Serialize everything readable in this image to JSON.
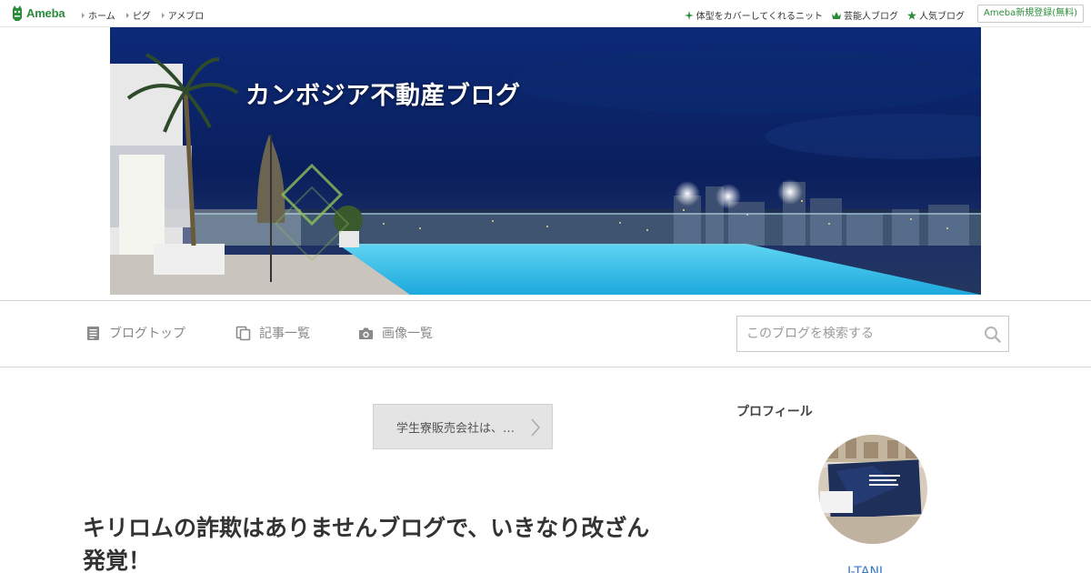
{
  "global_nav": {
    "logo_text": "Ameba",
    "links": [
      "ホーム",
      "ピグ",
      "アメブロ"
    ],
    "promo_links": [
      {
        "label": "体型をカバーしてくれるニット",
        "icon": "sparkle-icon"
      },
      {
        "label": "芸能人ブログ",
        "icon": "crown-icon"
      },
      {
        "label": "人気ブログ",
        "icon": "star-icon"
      }
    ],
    "register_label": "Ameba新規登録(無料)"
  },
  "header": {
    "blog_title": "カンボジア不動産ブログ"
  },
  "blog_nav": {
    "items": [
      {
        "label": "ブログトップ",
        "icon": "document-icon"
      },
      {
        "label": "記事一覧",
        "icon": "articles-icon"
      },
      {
        "label": "画像一覧",
        "icon": "camera-icon"
      }
    ],
    "search_placeholder": "このブログを検索する"
  },
  "main": {
    "prev_entry_label": "学生寮販売会社は、…",
    "article_title": "キリロムの詐欺はありませんブログで、いきなり改ざん発覚！"
  },
  "sidebar": {
    "profile_heading": "プロフィール",
    "profile_name": "J-TANI"
  },
  "colors": {
    "brand_green": "#2d8c3c",
    "link_blue": "#3a7ac8"
  }
}
